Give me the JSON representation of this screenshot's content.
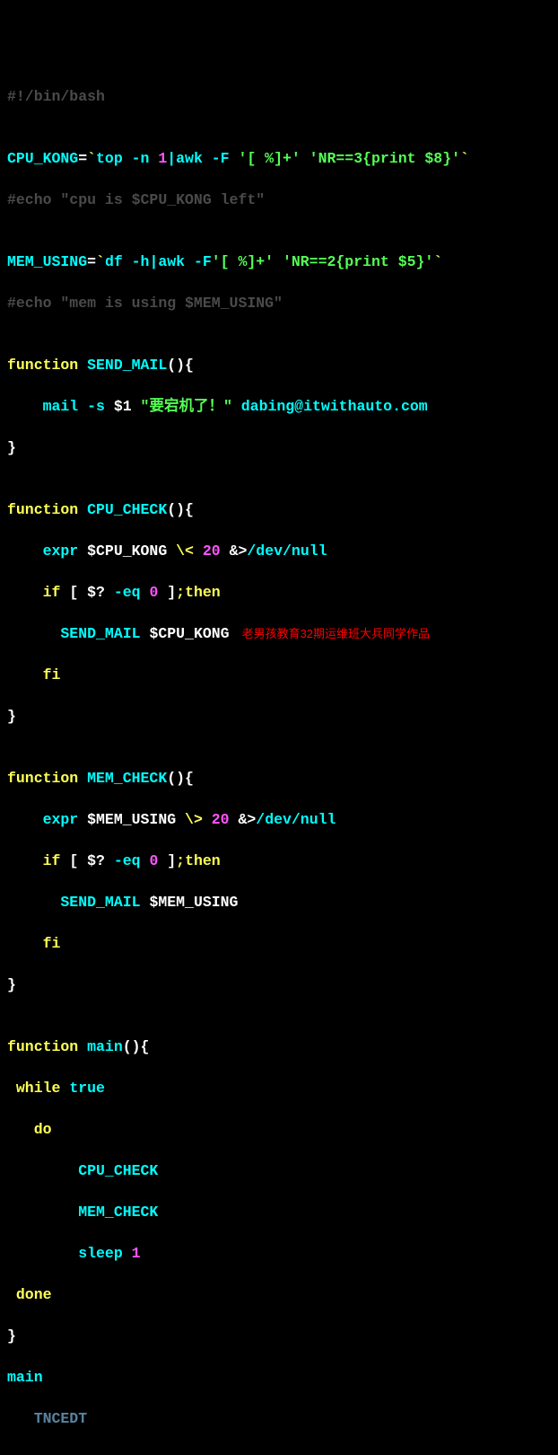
{
  "l01": {
    "a": "#!/bin/bash"
  },
  "l02": {
    "a": ""
  },
  "l03": {
    "a": "CPU_KONG",
    "b": "=",
    "c": "`",
    "d": "top -n ",
    "e": "1",
    "f": "|awk -F ",
    "g": "'[ %]+' 'NR==3{print $8}'",
    "h": "`"
  },
  "l04": {
    "a": "#echo \"cpu is $CPU_KONG left\""
  },
  "l05": {
    "a": ""
  },
  "l06": {
    "a": "MEM_USING",
    "b": "=",
    "c": "`",
    "d": "df -h|awk -F",
    "e": "'[ %]+' 'NR==2{print $5}'",
    "f": "`"
  },
  "l07": {
    "a": "#echo \"mem is using $MEM_USING\""
  },
  "l08": {
    "a": ""
  },
  "l09": {
    "a": "function",
    "b": " SEND_MAIL",
    "c": "(){"
  },
  "l10": {
    "a": "    mail -s ",
    "b": "$1 ",
    "c": "\"要宕机了！\"",
    "d": " dabing@itwithauto.com"
  },
  "l11": {
    "a": "}"
  },
  "l12": {
    "a": ""
  },
  "l13": {
    "a": "function",
    "b": " CPU_CHECK",
    "c": "(){"
  },
  "l14": {
    "a": "    expr ",
    "b": "$CPU_KONG ",
    "c": "\\< ",
    "d": "20 ",
    "e": "&>",
    "f": "/dev/null"
  },
  "l15": {
    "a": "    if ",
    "b": "[ ",
    "c": "$?",
    "d": " -eq ",
    "e": "0 ",
    "f": "]",
    "g": ";then"
  },
  "l16": {
    "a": "      SEND_MAIL ",
    "b": "$CPU_KONG",
    "ann": "老男孩教育32期运维班大兵同学作品"
  },
  "l17": {
    "a": "    fi"
  },
  "l18": {
    "a": "}"
  },
  "l19": {
    "a": ""
  },
  "l20": {
    "a": "function",
    "b": " MEM_CHECK",
    "c": "(){"
  },
  "l21": {
    "a": "    expr ",
    "b": "$MEM_USING ",
    "c": "\\> ",
    "d": "20 ",
    "e": "&>",
    "f": "/dev/null"
  },
  "l22": {
    "a": "    if ",
    "b": "[ ",
    "c": "$?",
    "d": " -eq ",
    "e": "0 ",
    "f": "]",
    "g": ";then"
  },
  "l23": {
    "a": "      SEND_MAIL ",
    "b": "$MEM_USING"
  },
  "l24": {
    "a": "    fi"
  },
  "l25": {
    "a": "}"
  },
  "l26": {
    "a": ""
  },
  "l27": {
    "a": "function",
    "b": " main",
    "c": "(){"
  },
  "l28": {
    "a": " while ",
    "b": "true"
  },
  "l29": {
    "a": "   do"
  },
  "l30": {
    "a": "        CPU_CHECK"
  },
  "l31": {
    "a": "        MEM_CHECK"
  },
  "l32": {
    "a": "        sleep ",
    "b": "1"
  },
  "l33": {
    "a": " done"
  },
  "l34": {
    "a": "}"
  },
  "l35": {
    "a": "main"
  },
  "l36": {
    "a": "   TNCEDT"
  }
}
